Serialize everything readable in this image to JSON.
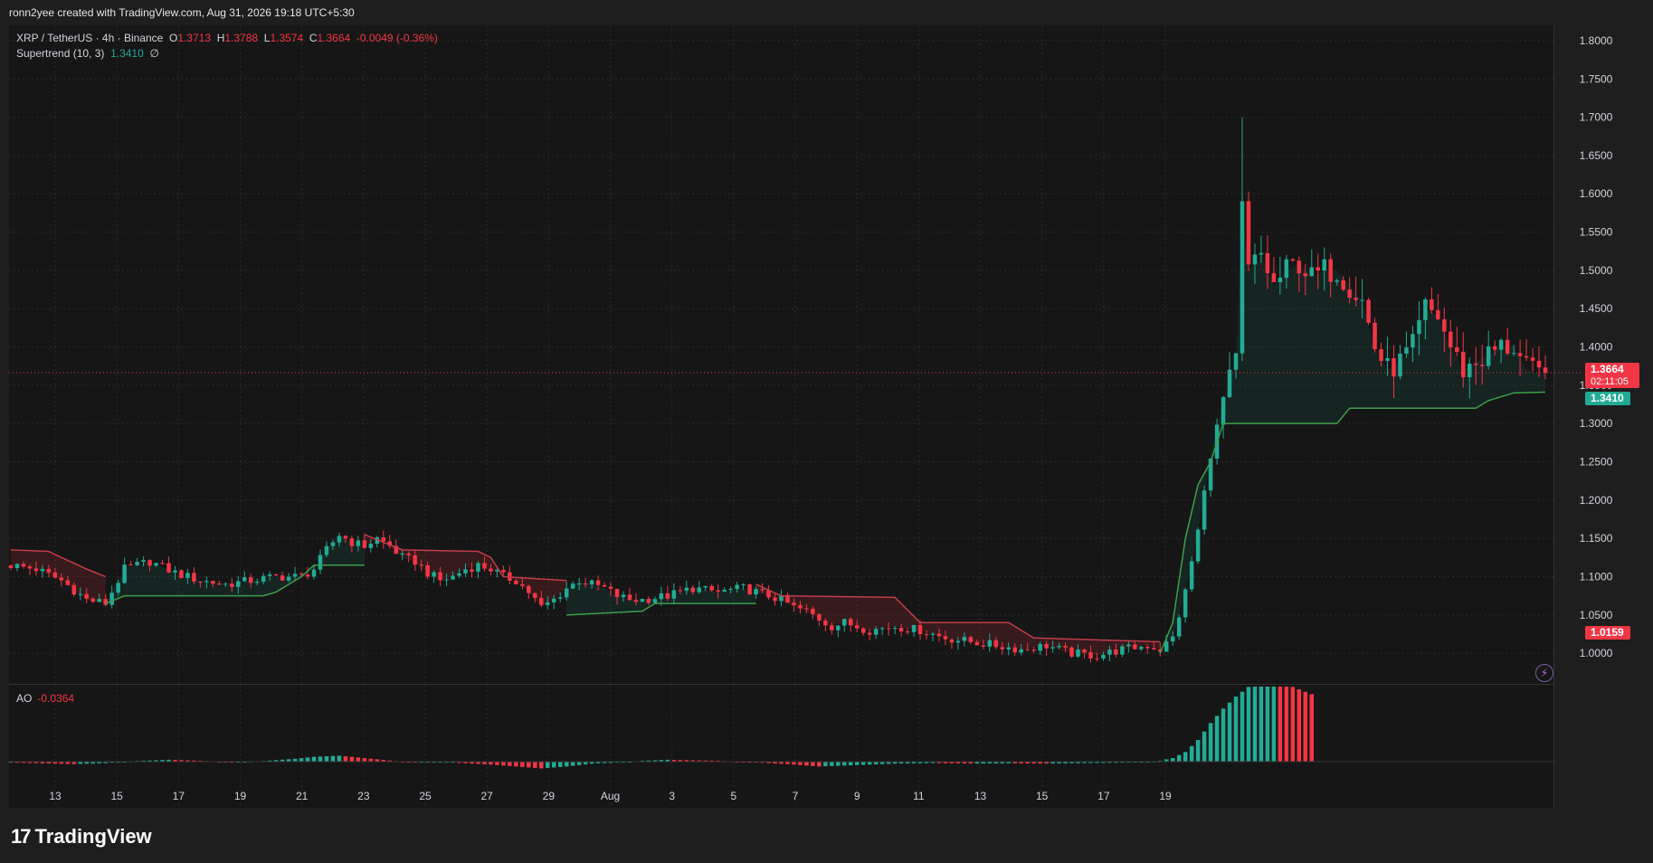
{
  "header": {
    "created_text": "ronn2yee created with TradingView.com, Aug 31, 2026 19:18 UTC+5:30"
  },
  "legend": {
    "symbol": "XRP / TetherUS · 4h · Binance",
    "o_label": "O",
    "o_value": "1.3713",
    "h_label": "H",
    "h_value": "1.3788",
    "l_label": "L",
    "l_value": "1.3574",
    "c_label": "C",
    "c_value": "1.3664",
    "change": "-0.0049 (-0.36%)",
    "indicator": "Supertrend (10, 3)",
    "indicator_value": "1.3410",
    "indicator_extra": "∅"
  },
  "ao_legend": {
    "label": "AO",
    "value": "-0.0364"
  },
  "price_tag": {
    "value": "1.3664",
    "timer": "02:11:05"
  },
  "supertrend_tag": {
    "value": "1.3410"
  },
  "low_tag": {
    "value": "1.0159"
  },
  "branding": {
    "logo_mark": "17",
    "logo_text": "TradingView"
  },
  "icons": {
    "bolt": "lightning-bolt-icon"
  },
  "colors": {
    "background": "#161616",
    "grid": "#2a2a2a",
    "up": "#22ab94",
    "down": "#f23645",
    "supertrend_up": "#3d9f4a",
    "supertrend_down": "#c23b4a",
    "text": "#d1d4dc"
  },
  "chart_data": {
    "type": "candlestick",
    "symbol": "XRP / TetherUS",
    "interval": "4h",
    "exchange": "Binance",
    "ylim": [
      0.96,
      1.82
    ],
    "y_ticks": [
      "1.8000",
      "1.7500",
      "1.7000",
      "1.6500",
      "1.6000",
      "1.5500",
      "1.5000",
      "1.4500",
      "1.4000",
      "1.3500",
      "1.3000",
      "1.2500",
      "1.2000",
      "1.1500",
      "1.1000",
      "1.0500",
      "1.0000"
    ],
    "x_ticks": [
      "13",
      "15",
      "17",
      "19",
      "21",
      "23",
      "25",
      "27",
      "29",
      "Aug",
      "3",
      "5",
      "7",
      "9",
      "11",
      "13",
      "15",
      "17",
      "19"
    ],
    "last_close": 1.3664,
    "supertrend_last": 1.341,
    "price_path": [
      [
        0,
        1.115
      ],
      [
        4,
        1.11
      ],
      [
        8,
        1.095
      ],
      [
        12,
        1.07
      ],
      [
        15,
        1.065
      ],
      [
        18,
        1.11
      ],
      [
        22,
        1.12
      ],
      [
        26,
        1.105
      ],
      [
        30,
        1.095
      ],
      [
        34,
        1.09
      ],
      [
        38,
        1.095
      ],
      [
        42,
        1.1
      ],
      [
        46,
        1.1
      ],
      [
        48,
        1.11
      ],
      [
        50,
        1.135
      ],
      [
        52,
        1.155
      ],
      [
        54,
        1.145
      ],
      [
        56,
        1.14
      ],
      [
        58,
        1.15
      ],
      [
        60,
        1.14
      ],
      [
        62,
        1.125
      ],
      [
        64,
        1.12
      ],
      [
        66,
        1.105
      ],
      [
        68,
        1.095
      ],
      [
        70,
        1.1
      ],
      [
        72,
        1.11
      ],
      [
        74,
        1.115
      ],
      [
        76,
        1.11
      ],
      [
        78,
        1.1
      ],
      [
        80,
        1.095
      ],
      [
        82,
        1.08
      ],
      [
        84,
        1.06
      ],
      [
        86,
        1.07
      ],
      [
        88,
        1.085
      ],
      [
        90,
        1.095
      ],
      [
        92,
        1.09
      ],
      [
        94,
        1.085
      ],
      [
        96,
        1.075
      ],
      [
        98,
        1.07
      ],
      [
        100,
        1.07
      ],
      [
        104,
        1.075
      ],
      [
        108,
        1.085
      ],
      [
        112,
        1.08
      ],
      [
        116,
        1.085
      ],
      [
        118,
        1.08
      ],
      [
        120,
        1.075
      ],
      [
        122,
        1.07
      ],
      [
        124,
        1.06
      ],
      [
        126,
        1.055
      ],
      [
        128,
        1.045
      ],
      [
        130,
        1.035
      ],
      [
        132,
        1.04
      ],
      [
        134,
        1.035
      ],
      [
        136,
        1.03
      ],
      [
        140,
        1.035
      ],
      [
        144,
        1.03
      ],
      [
        148,
        1.02
      ],
      [
        152,
        1.015
      ],
      [
        156,
        1.01
      ],
      [
        160,
        1.005
      ],
      [
        164,
        1.01
      ],
      [
        168,
        1.0
      ],
      [
        172,
        0.997
      ],
      [
        176,
        1.005
      ],
      [
        180,
        1.01
      ],
      [
        182,
        1.005
      ],
      [
        184,
        1.02
      ],
      [
        186,
        1.08
      ],
      [
        188,
        1.16
      ],
      [
        190,
        1.26
      ],
      [
        192,
        1.33
      ],
      [
        194,
        1.38
      ],
      [
        195,
        1.58
      ],
      [
        196,
        1.5
      ],
      [
        198,
        1.52
      ],
      [
        200,
        1.48
      ],
      [
        202,
        1.5
      ],
      [
        204,
        1.51
      ],
      [
        206,
        1.49
      ],
      [
        208,
        1.5
      ],
      [
        210,
        1.5
      ],
      [
        212,
        1.48
      ],
      [
        214,
        1.46
      ],
      [
        216,
        1.4
      ],
      [
        218,
        1.37
      ],
      [
        220,
        1.38
      ],
      [
        222,
        1.4
      ],
      [
        224,
        1.45
      ],
      [
        226,
        1.44
      ],
      [
        228,
        1.4
      ],
      [
        230,
        1.37
      ],
      [
        232,
        1.38
      ],
      [
        234,
        1.39
      ],
      [
        236,
        1.4
      ],
      [
        238,
        1.4
      ],
      [
        240,
        1.37
      ],
      [
        242,
        1.365
      ],
      [
        243,
        1.3664
      ]
    ],
    "supertrend_segments": [
      {
        "trend": "down",
        "points": [
          [
            0,
            1.135
          ],
          [
            6,
            1.133
          ],
          [
            8,
            1.125
          ],
          [
            12,
            1.11
          ],
          [
            15,
            1.1
          ]
        ]
      },
      {
        "trend": "up",
        "points": [
          [
            15,
            1.065
          ],
          [
            18,
            1.075
          ],
          [
            40,
            1.075
          ],
          [
            42,
            1.08
          ],
          [
            46,
            1.1
          ],
          [
            48,
            1.115
          ],
          [
            56,
            1.115
          ]
        ]
      },
      {
        "trend": "down",
        "points": [
          [
            56,
            1.155
          ],
          [
            62,
            1.135
          ],
          [
            74,
            1.133
          ],
          [
            76,
            1.125
          ],
          [
            78,
            1.1
          ],
          [
            88,
            1.095
          ]
        ]
      },
      {
        "trend": "up",
        "points": [
          [
            88,
            1.05
          ],
          [
            100,
            1.055
          ],
          [
            102,
            1.065
          ],
          [
            118,
            1.065
          ]
        ]
      },
      {
        "trend": "down",
        "points": [
          [
            118,
            1.09
          ],
          [
            122,
            1.075
          ],
          [
            140,
            1.073
          ],
          [
            144,
            1.04
          ],
          [
            158,
            1.04
          ],
          [
            162,
            1.02
          ],
          [
            182,
            1.015
          ]
        ]
      },
      {
        "trend": "up",
        "points": [
          [
            182,
            1.0
          ],
          [
            184,
            1.04
          ],
          [
            186,
            1.15
          ],
          [
            188,
            1.22
          ],
          [
            190,
            1.25
          ],
          [
            192,
            1.3
          ],
          [
            210,
            1.3
          ],
          [
            212,
            1.32
          ],
          [
            232,
            1.32
          ],
          [
            234,
            1.33
          ],
          [
            236,
            1.335
          ],
          [
            238,
            1.34
          ],
          [
            243,
            1.341
          ]
        ]
      }
    ],
    "ao_path": [
      [
        0,
        -0.004
      ],
      [
        10,
        -0.01
      ],
      [
        15,
        -0.006
      ],
      [
        20,
        0.003
      ],
      [
        25,
        0.008
      ],
      [
        30,
        0.004
      ],
      [
        35,
        -0.002
      ],
      [
        40,
        0.003
      ],
      [
        45,
        0.012
      ],
      [
        48,
        0.02
      ],
      [
        52,
        0.025
      ],
      [
        56,
        0.015
      ],
      [
        60,
        0.005
      ],
      [
        64,
        -0.004
      ],
      [
        70,
        -0.004
      ],
      [
        76,
        -0.012
      ],
      [
        80,
        -0.02
      ],
      [
        84,
        -0.028
      ],
      [
        88,
        -0.02
      ],
      [
        92,
        -0.008
      ],
      [
        96,
        -0.004
      ],
      [
        100,
        0.004
      ],
      [
        104,
        0.008
      ],
      [
        108,
        0.006
      ],
      [
        112,
        0.004
      ],
      [
        118,
        -0.003
      ],
      [
        124,
        -0.012
      ],
      [
        128,
        -0.02
      ],
      [
        132,
        -0.016
      ],
      [
        136,
        -0.012
      ],
      [
        140,
        -0.008
      ],
      [
        146,
        -0.006
      ],
      [
        152,
        -0.008
      ],
      [
        158,
        -0.007
      ],
      [
        164,
        -0.008
      ],
      [
        170,
        -0.006
      ],
      [
        176,
        -0.004
      ],
      [
        180,
        -0.002
      ],
      [
        182,
        0.004
      ],
      [
        184,
        0.015
      ],
      [
        186,
        0.04
      ],
      [
        188,
        0.09
      ],
      [
        190,
        0.16
      ],
      [
        192,
        0.22
      ],
      [
        194,
        0.27
      ],
      [
        196,
        0.31
      ],
      [
        198,
        0.33
      ],
      [
        200,
        0.34
      ],
      [
        202,
        0.32
      ],
      [
        204,
        0.3
      ],
      [
        206,
        0.28
      ]
    ]
  }
}
